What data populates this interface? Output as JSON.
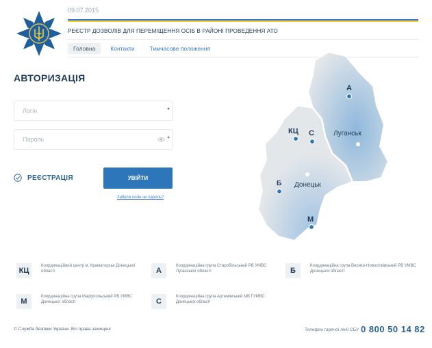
{
  "header": {
    "date": "09.07.2015",
    "title": "РЕЄСТР ДОЗВОЛІВ ДЛЯ ПЕРЕМІЩЕННЯ ОСІБ В РАЙОНІ ПРОВЕДЕННЯ АТО",
    "logo_icon": "sbu-emblem-icon",
    "stripe_colors": [
      "#3a78c8",
      "#f3d031"
    ]
  },
  "nav": {
    "items": [
      {
        "label": "Головна",
        "active": true
      },
      {
        "label": "Контакти",
        "active": false
      },
      {
        "label": "Тимчасове положення",
        "active": false
      }
    ]
  },
  "auth": {
    "title": "АВТОРИЗАЦІЯ",
    "login_placeholder": "Логін",
    "password_placeholder": "Пароль",
    "required_mark": "*",
    "register_label": "РЕЄСТРАЦІЯ",
    "login_button": "УВІЙТИ",
    "forgot_link": "Забули логін чи пароль?"
  },
  "map": {
    "labels": {
      "a": "А",
      "kc": "КЦ",
      "c": "С",
      "luhansk": "Луганськ",
      "b": "Б",
      "donetsk": "Донецьк",
      "m": "М"
    },
    "region_color": "#e4e7ea",
    "highlight_color": "#8fb8dc",
    "point_color": "#2d76b9"
  },
  "legend": {
    "items": [
      {
        "code": "КЦ",
        "text": "Координаційний центр м. Краматорськ Донецької області"
      },
      {
        "code": "А",
        "text": "Координаційна група Старобільський РВ УМВС Луганської області"
      },
      {
        "code": "Б",
        "text": "Координаційна група Велико-Новосілківський РВ УМВС Донецької області"
      },
      {
        "code": "М",
        "text": "Координаційна група Маріупольський РВ УМВС Донецької області"
      },
      {
        "code": "С",
        "text": "Координаційна група Артемівський МВ ГУМВС Донецької області"
      }
    ]
  },
  "footer": {
    "copyright": "© Служба безпеки України. Всі права захищені",
    "hotline_label": "Телефон гарячої лінії СБУ",
    "hotline_number": "0 800 50 14 82"
  }
}
